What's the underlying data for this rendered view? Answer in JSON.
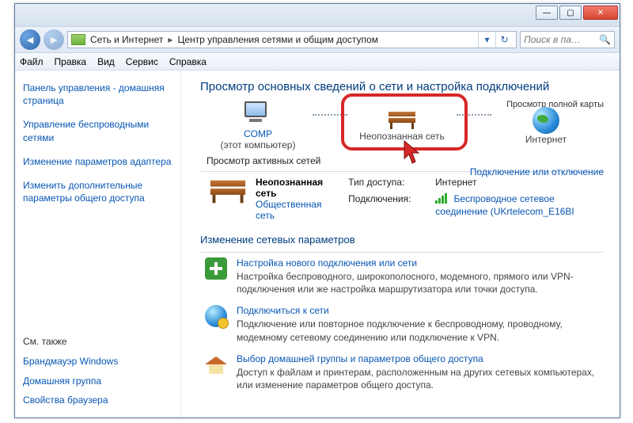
{
  "titlebar": {
    "min": "—",
    "max": "▢",
    "close": "✕"
  },
  "address": {
    "seg1": "Сеть и Интернет",
    "seg2": "Центр управления сетями и общим доступом"
  },
  "search": {
    "placeholder": "Поиск в па…"
  },
  "menu": {
    "file": "Файл",
    "edit": "Правка",
    "view": "Вид",
    "service": "Сервис",
    "help": "Справка"
  },
  "sidebar": {
    "items": [
      "Панель управления - домашняя страница",
      "Управление беспроводными сетями",
      "Изменение параметров адаптера",
      "Изменить дополнительные параметры общего доступа"
    ],
    "also_label": "См. также",
    "also": [
      "Брандмауэр Windows",
      "Домашняя группа",
      "Свойства браузера"
    ]
  },
  "content": {
    "heading": "Просмотр основных сведений о сети и настройка подключений",
    "full_map": "Просмотр полной карты",
    "map": {
      "comp_label": "COMP",
      "comp_sub": "(этот компьютер)",
      "mid_label": "Неопознанная сеть",
      "net_label": "Интернет"
    },
    "active_label": "Просмотр активных сетей",
    "conn_link": "Подключение или отключение",
    "net": {
      "title": "Неопознанная сеть",
      "type": "Общественная сеть",
      "k_access": "Тип доступа:",
      "v_access": "Интернет",
      "k_conn": "Подключения:",
      "v_conn": "Беспроводное сетевое соединение (UKrtelecom_E16BI"
    },
    "section2": "Изменение сетевых параметров",
    "tasks": [
      {
        "t": "Настройка нового подключения или сети",
        "d": "Настройка беспроводного, широкополосного, модемного, прямого или VPN-подключения или же настройка маршрутизатора или точки доступа."
      },
      {
        "t": "Подключиться к сети",
        "d": "Подключение или повторное подключение к беспроводному, проводному, модемному сетевому соединению или подключение к VPN."
      },
      {
        "t": "Выбор домашней группы и параметров общего доступа",
        "d": "Доступ к файлам и принтерам, расположенным на других сетевых компьютерах, или изменение параметров общего доступа."
      }
    ]
  }
}
